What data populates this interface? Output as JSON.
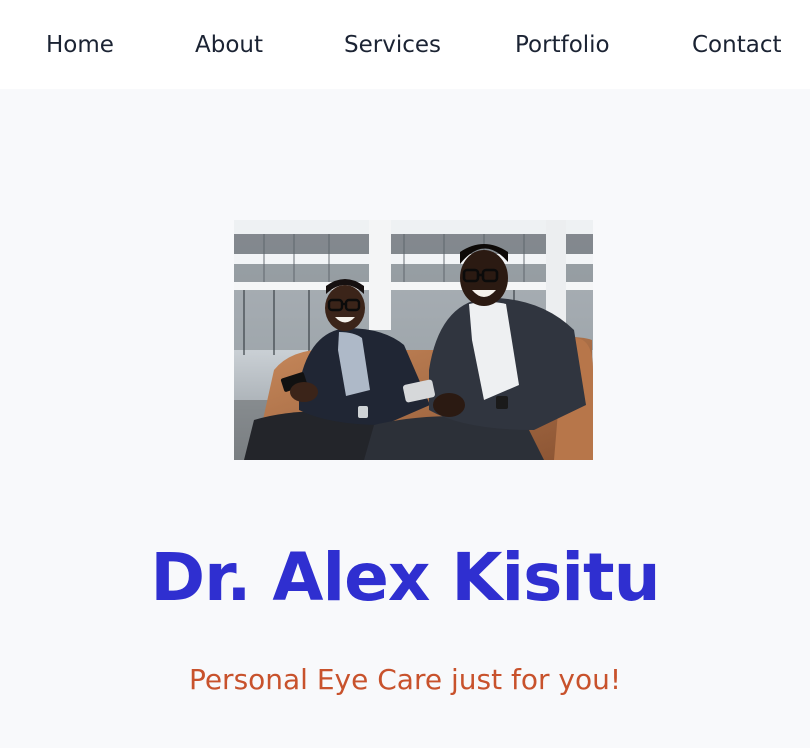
{
  "nav": {
    "items": [
      {
        "label": "Home"
      },
      {
        "label": "About"
      },
      {
        "label": "Services"
      },
      {
        "label": "Portfolio"
      },
      {
        "label": "Contact"
      }
    ]
  },
  "hero": {
    "name": "Dr. Alex Kisitu",
    "tagline": "Personal Eye Care just for you!",
    "name_color": "#2f2fd0",
    "tagline_color": "#c8522c"
  }
}
